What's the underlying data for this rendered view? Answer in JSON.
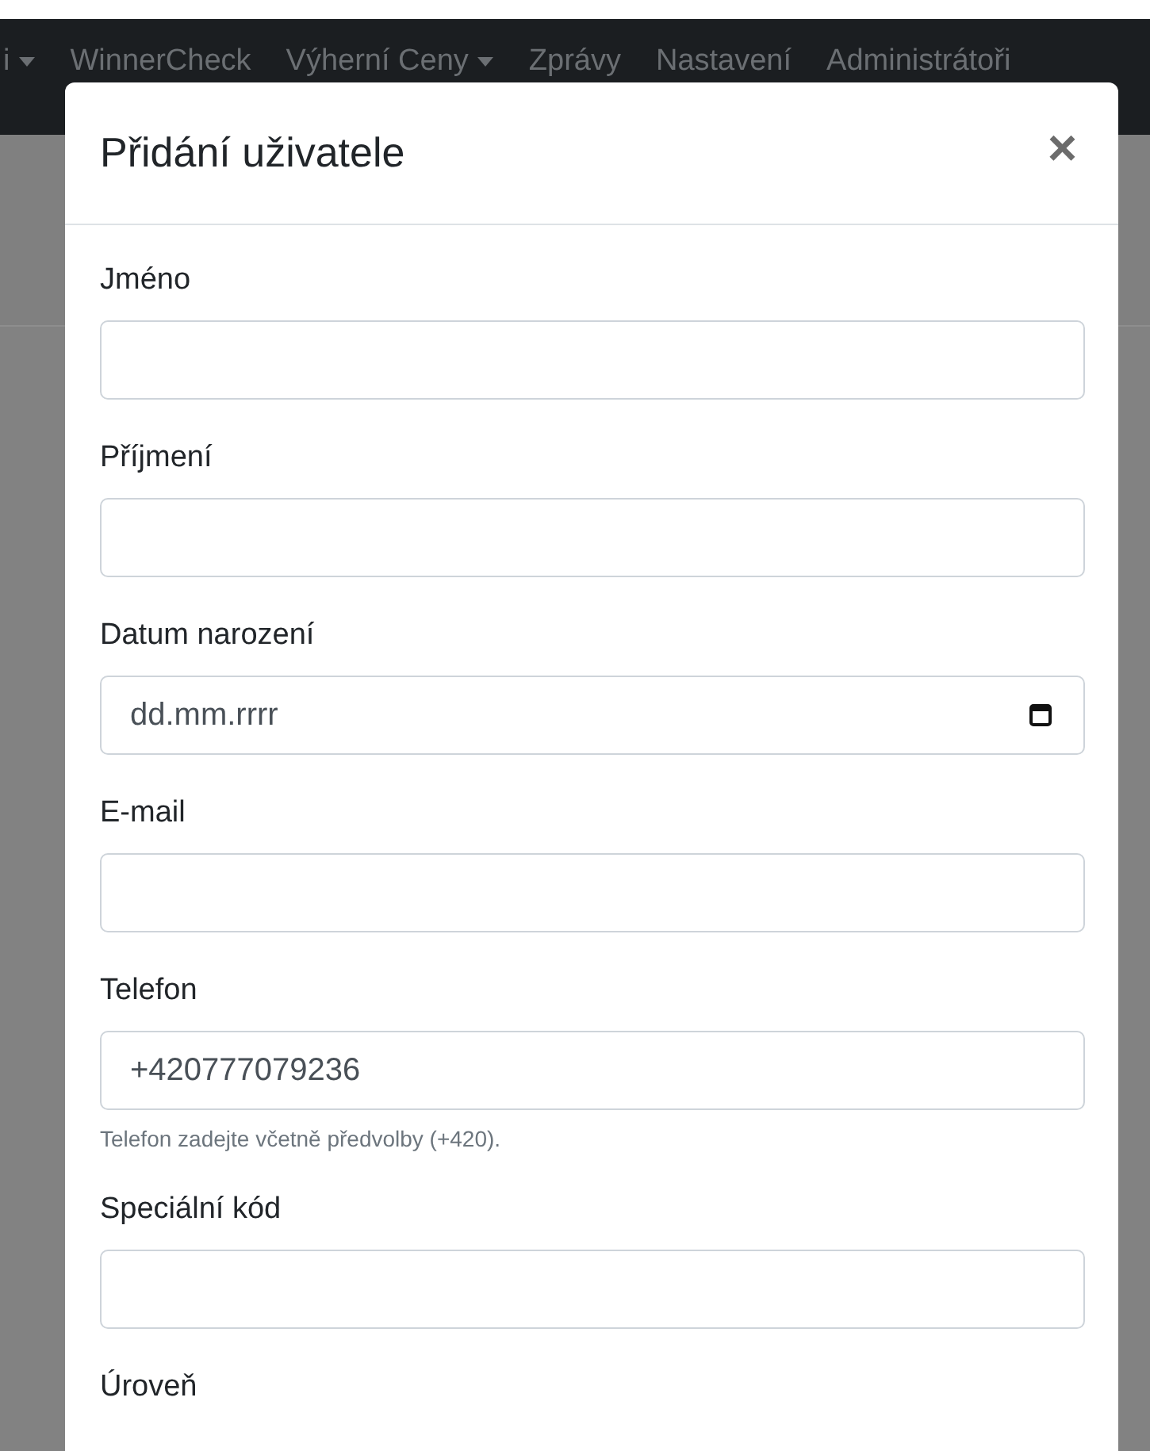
{
  "navbar": {
    "items": [
      {
        "label": "i",
        "dropdown": true
      },
      {
        "label": "WinnerCheck",
        "dropdown": false
      },
      {
        "label": "Výherní Ceny",
        "dropdown": true
      },
      {
        "label": "Zprávy",
        "dropdown": false
      },
      {
        "label": "Nastavení",
        "dropdown": false
      },
      {
        "label": "Administrátoři",
        "dropdown": false
      }
    ]
  },
  "modal": {
    "title": "Přidání uživatele",
    "close": "×",
    "fields": [
      {
        "label": "Jméno",
        "kind": "text"
      },
      {
        "label": "Příjmení",
        "kind": "text"
      },
      {
        "label": "Datum narození",
        "kind": "date",
        "placeholder": "dd.mm.rrrr"
      },
      {
        "label": "E-mail",
        "kind": "text"
      },
      {
        "label": "Telefon",
        "kind": "text",
        "value": "+420777079236",
        "help": "Telefon zadejte včetně předvolby (+420)."
      },
      {
        "label": "Speciální kód",
        "kind": "text"
      },
      {
        "label": "Úroveň",
        "kind": "other"
      }
    ]
  }
}
